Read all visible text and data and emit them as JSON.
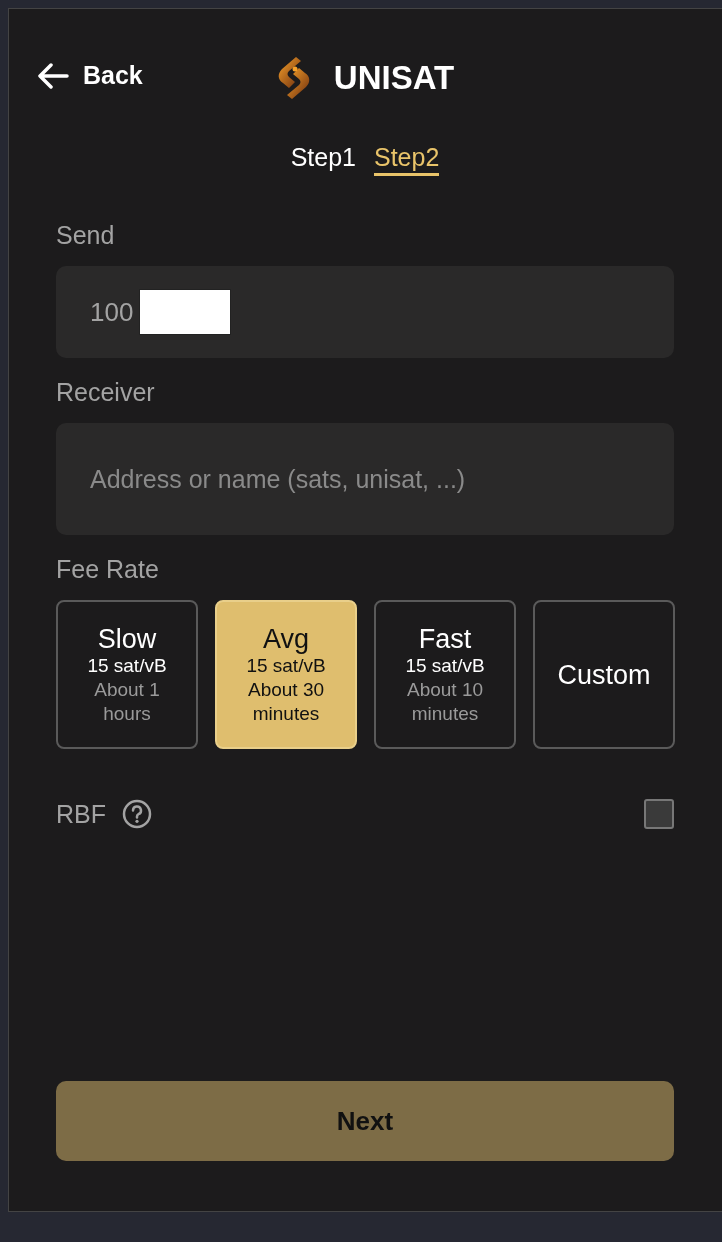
{
  "header": {
    "back": "Back",
    "brand": "UNISAT"
  },
  "steps": [
    {
      "label": "Step1",
      "selected": false
    },
    {
      "label": "Step2",
      "selected": true
    }
  ],
  "send": {
    "label": "Send",
    "value": "100"
  },
  "receiver": {
    "label": "Receiver",
    "placeholder": "Address or name (sats, unisat, ...)"
  },
  "fee_rate": {
    "label": "Fee Rate",
    "options": [
      {
        "title": "Slow",
        "rate": "15 sat/vB",
        "time": "About 1 hours",
        "selected": false
      },
      {
        "title": "Avg",
        "rate": "15 sat/vB",
        "time": "About 30 minutes",
        "selected": true
      },
      {
        "title": "Fast",
        "rate": "15 sat/vB",
        "time": "About 10 minutes",
        "selected": false
      },
      {
        "title": "Custom",
        "selected": false
      }
    ]
  },
  "rbf": {
    "label": "RBF",
    "checked": false
  },
  "next": {
    "label": "Next",
    "disabled": true
  }
}
